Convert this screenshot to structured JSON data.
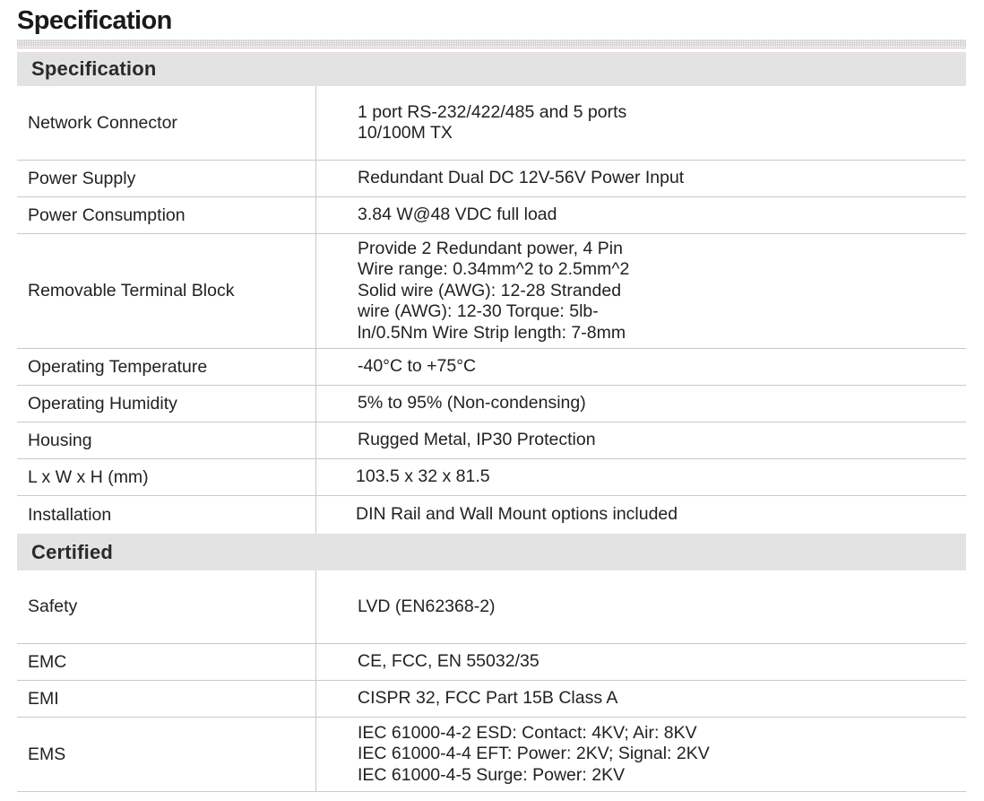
{
  "page": {
    "title": "Specification"
  },
  "sections": [
    {
      "title": "Specification",
      "rows": [
        {
          "label": "Network Connector",
          "value": "1 port RS-232/422/485 and 5 ports\n10/100M TX"
        },
        {
          "label": "Power Supply",
          "value": "Redundant Dual DC 12V-56V Power Input"
        },
        {
          "label": "Power Consumption",
          "value": "3.84 W@48 VDC full load"
        },
        {
          "label": "Removable Terminal Block",
          "value": "Provide 2 Redundant power, 4 Pin\nWire range: 0.34mm^2 to 2.5mm^2\nSolid wire (AWG): 12-28 Stranded\nwire (AWG): 12-30 Torque: 5lb-\nln/0.5Nm Wire Strip length: 7-8mm"
        },
        {
          "label": "Operating Temperature",
          "value": "-40°C to +75°C"
        },
        {
          "label": "Operating Humidity",
          "value": "5% to 95% (Non-condensing)"
        },
        {
          "label": "Housing",
          "value": "Rugged Metal, IP30 Protection"
        },
        {
          "label": "L x W x H (mm)",
          "value": "103.5 x 32 x 81.5"
        },
        {
          "label": "Installation",
          "value": "DIN Rail and Wall Mount options included"
        }
      ]
    },
    {
      "title": "Certified",
      "rows": [
        {
          "label": "Safety",
          "value": "LVD (EN62368-2)"
        },
        {
          "label": "EMC",
          "value": "CE, FCC, EN 55032/35"
        },
        {
          "label": "EMI",
          "value": "CISPR 32, FCC Part 15B Class A"
        },
        {
          "label": "EMS",
          "value": "IEC 61000-4-2 ESD: Contact: 4KV; Air: 8KV\nIEC 61000-4-4 EFT: Power: 2KV; Signal: 2KV\nIEC 61000-4-5 Surge: Power: 2KV"
        }
      ]
    }
  ]
}
